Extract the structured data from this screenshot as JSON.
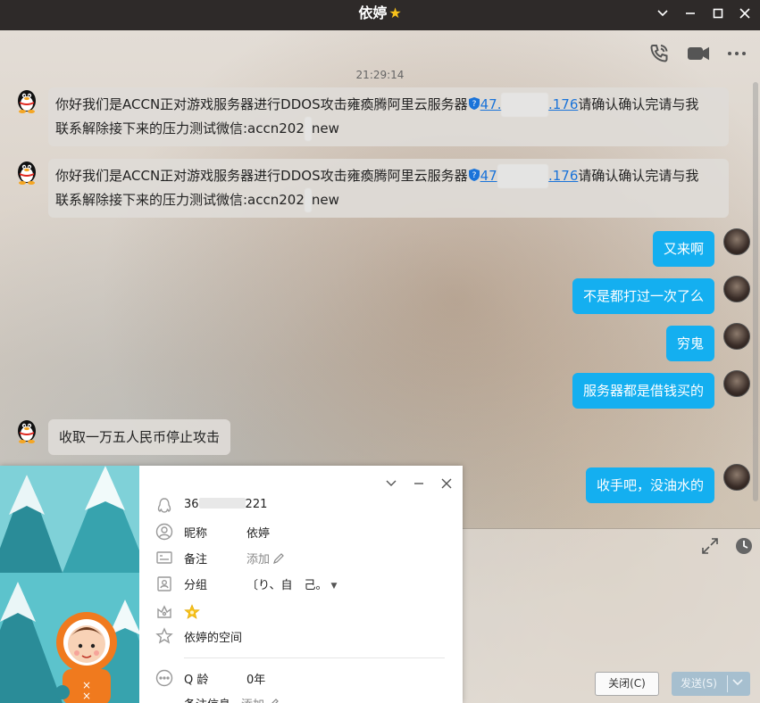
{
  "window": {
    "title": "依婷",
    "title_badge_icon": "star-icon",
    "controls": [
      "chevron-down-icon",
      "minimize-icon",
      "maximize-icon",
      "close-icon"
    ]
  },
  "toolbar": {
    "icons": [
      "phone-icon",
      "video-icon",
      "more-icon"
    ]
  },
  "chat": {
    "timestamp": "21:29:14",
    "messages": [
      {
        "side": "in",
        "text_before_link": "你好我们是ACCN正对游戏服务器进行DDOS攻击雍瘓腾阿里云服务器",
        "link_start": "47.",
        "link_end": ".176",
        "text_after_link": "请确认确认完请与我",
        "line2": "联系解除接下来的压力测试微信:accn202",
        "line2_end": "new"
      },
      {
        "side": "in",
        "text_before_link": "你好我们是ACCN正对游戏服务器进行DDOS攻击雍瘓腾阿里云服务器",
        "link_start": "47",
        "link_end": ".176",
        "text_after_link": "请确认确认完请与我",
        "line2": "联系解除接下来的压力测试微信:accn202",
        "line2_end": "new"
      },
      {
        "side": "out",
        "text": "又来啊"
      },
      {
        "side": "out",
        "text": "不是都打过一次了么"
      },
      {
        "side": "out",
        "text": "穷鬼"
      },
      {
        "side": "out",
        "text": "服务器都是借钱买的"
      },
      {
        "side": "in",
        "text": "收取一万五人民币停止攻击"
      },
      {
        "side": "out",
        "text": "收手吧，没油水的"
      }
    ]
  },
  "input": {
    "icons": [
      "expand-icon",
      "clock-icon"
    ],
    "close_button": "关闭(C)",
    "send_button": "发送(S)",
    "send_dropdown_icon": "chevron-down-icon"
  },
  "profile_popup": {
    "controls": [
      "chevron-down-icon",
      "minimize-icon",
      "close-icon"
    ],
    "qq_number_start": "36",
    "qq_number_end": "221",
    "nickname_label": "昵称",
    "nickname_value": "依婷",
    "remark_label": "备注",
    "remark_value": "添加",
    "group_label": "分组",
    "group_value": "〔り、自　己。",
    "level_icon": "star-icon",
    "space_link": "依婷的空间",
    "qage_label": "Q 龄",
    "qage_value": "0年",
    "remark_info_label": "备注信息",
    "remark_info_value": "添加"
  },
  "colors": {
    "titlebar": "#2e2a29",
    "bubble_out": "#14aff0",
    "bubble_in": "#dedbd7",
    "link": "#1a73d9",
    "star": "#f7c11b"
  }
}
